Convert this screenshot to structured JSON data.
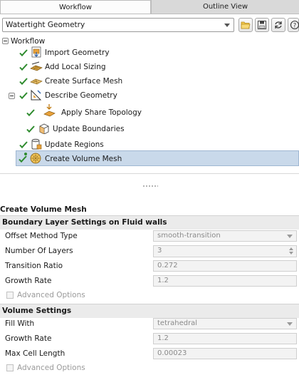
{
  "tabs": [
    {
      "label": "Workflow",
      "active": true
    },
    {
      "label": "Outline View",
      "active": false
    }
  ],
  "workflow_selector": {
    "value": "Watertight Geometry",
    "icons": [
      "open-folder-icon",
      "save-icon",
      "refresh-icon",
      "help-icon"
    ]
  },
  "tree": {
    "root_label": "Workflow",
    "items": [
      {
        "label": "Import Geometry",
        "icon": "import-geometry-icon",
        "done": true
      },
      {
        "label": "Add Local Sizing",
        "icon": "local-sizing-icon",
        "done": true
      },
      {
        "label": "Create Surface Mesh",
        "icon": "surface-mesh-icon",
        "done": true
      },
      {
        "label": "Describe Geometry",
        "icon": "describe-geometry-icon",
        "done": true,
        "expanded": true
      },
      {
        "label": "Apply Share Topology",
        "icon": "share-topology-icon",
        "done": true
      },
      {
        "label": "Update Boundaries",
        "icon": "update-boundaries-icon",
        "done": true
      },
      {
        "label": "Update Regions",
        "icon": "update-regions-icon",
        "done": true
      },
      {
        "label": "Create Volume Mesh",
        "icon": "volume-mesh-icon",
        "done": true,
        "selected": true
      }
    ]
  },
  "task": {
    "title": "Create Volume Mesh",
    "boundary_layer": {
      "heading": "Boundary Layer Settings on Fluid walls",
      "offset_method_label": "Offset Method Type",
      "offset_method_value": "smooth-transition",
      "layers_label": "Number Of Layers",
      "layers_value": "3",
      "transition_ratio_label": "Transition Ratio",
      "transition_ratio_value": "0.272",
      "growth_rate_label": "Growth Rate",
      "growth_rate_value": "1.2",
      "advanced_label": "Advanced Options",
      "advanced_checked": false
    },
    "volume": {
      "heading": "Volume Settings",
      "fill_with_label": "Fill With",
      "fill_with_value": "tetrahedral",
      "growth_rate_label": "Growth Rate",
      "growth_rate_value": "1.2",
      "max_cell_label": "Max Cell Length",
      "max_cell_value": "0.00023",
      "advanced_label": "Advanced Options",
      "advanced_checked": false
    }
  },
  "colors": {
    "check_green": "#2e8b2e",
    "selected_bg": "#c9d9ea",
    "section_bg": "#ebebeb"
  }
}
